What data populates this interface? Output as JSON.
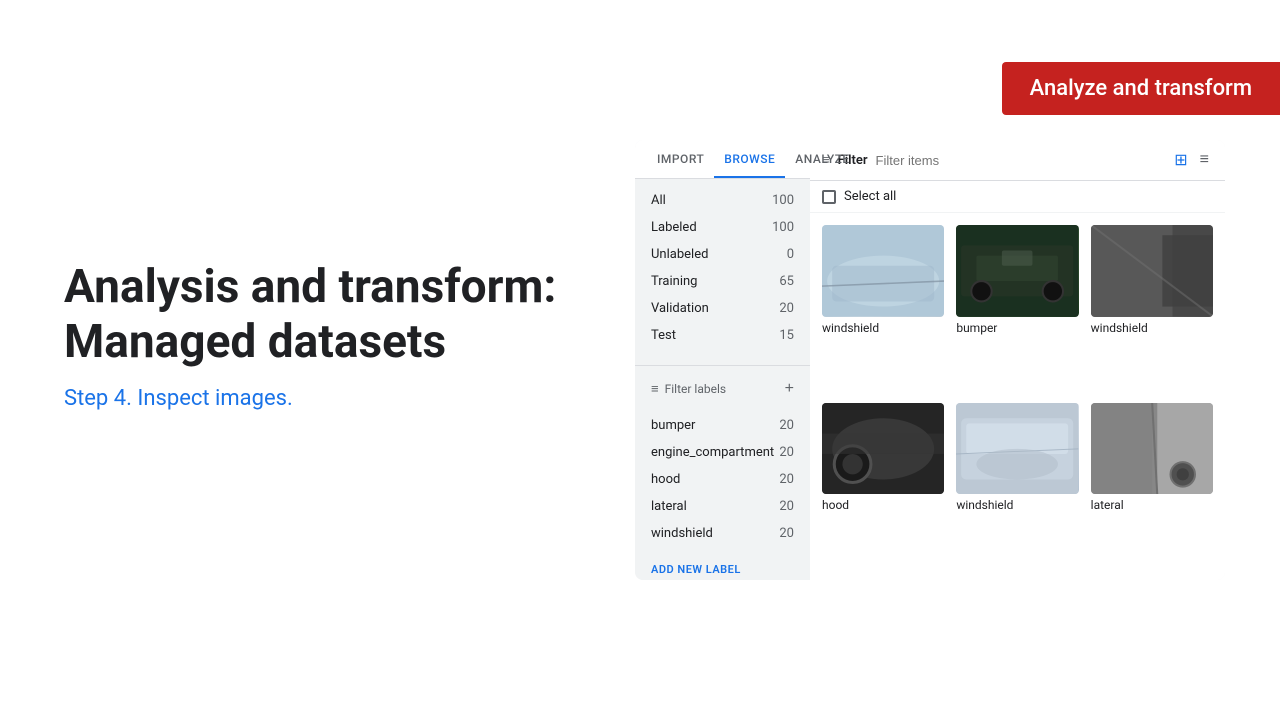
{
  "badge": {
    "text": "Analyze and transform",
    "bg_color": "#c5221f"
  },
  "left": {
    "title_line1": "Analysis and transform:",
    "title_line2": "Managed datasets",
    "step_label": "Step 4. Inspect images."
  },
  "panel": {
    "tabs": [
      {
        "id": "import",
        "label": "IMPORT",
        "active": false
      },
      {
        "id": "browse",
        "label": "BROWSE",
        "active": true
      },
      {
        "id": "analyze",
        "label": "ANALYZE",
        "active": false
      }
    ],
    "sidebar": {
      "items": [
        {
          "label": "All",
          "count": "100"
        },
        {
          "label": "Labeled",
          "count": "100"
        },
        {
          "label": "Unlabeled",
          "count": "0"
        },
        {
          "label": "Training",
          "count": "65"
        },
        {
          "label": "Validation",
          "count": "20"
        },
        {
          "label": "Test",
          "count": "15"
        }
      ],
      "filter_label": "Filter labels",
      "label_items": [
        {
          "label": "bumper",
          "count": "20"
        },
        {
          "label": "engine_compartment",
          "count": "20"
        },
        {
          "label": "hood",
          "count": "20"
        },
        {
          "label": "lateral",
          "count": "20"
        },
        {
          "label": "windshield",
          "count": "20"
        }
      ],
      "add_label_btn": "ADD NEW LABEL"
    },
    "content": {
      "filter_placeholder": "Filter items",
      "filter_label": "Filter",
      "select_all": "Select all",
      "images": [
        {
          "label": "windshield",
          "style": "car-img-1"
        },
        {
          "label": "bumper",
          "style": "car-img-2"
        },
        {
          "label": "windshield",
          "style": "car-img-3"
        },
        {
          "label": "hood",
          "style": "car-img-4"
        },
        {
          "label": "windshield",
          "style": "car-img-5"
        },
        {
          "label": "lateral",
          "style": "car-img-6"
        }
      ]
    }
  }
}
